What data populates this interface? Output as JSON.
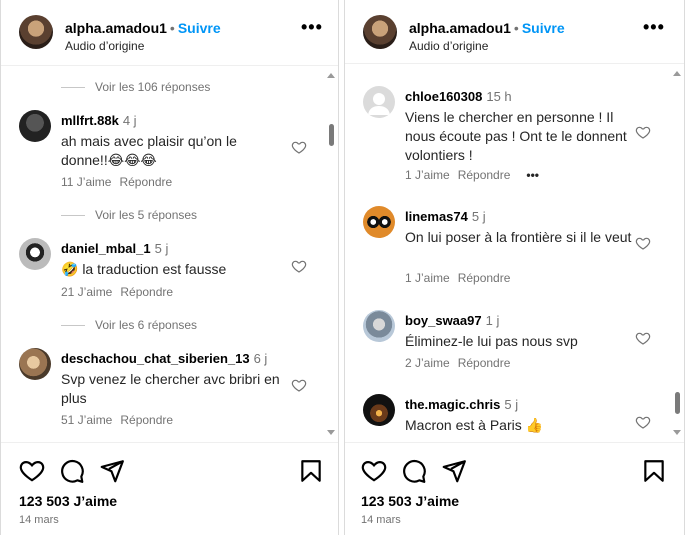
{
  "post": {
    "username": "alpha.amadou1",
    "separator": "•",
    "follow_label": "Suivre",
    "audio_label": "Audio d’origine",
    "more_label": "•••",
    "likes": "123 503 J’aime",
    "date": "14 mars"
  },
  "left": {
    "items": [
      {
        "type": "replies",
        "label": "Voir les 106 réponses"
      },
      {
        "type": "comment",
        "username": "mllfrt.88k",
        "time": "4 j",
        "text": "ah mais avec plaisir qu’on le donne!!😂😂😂",
        "likes": "11 J’aime",
        "reply": "Répondre"
      },
      {
        "type": "replies",
        "label": "Voir les 5 réponses"
      },
      {
        "type": "comment",
        "username": "daniel_mbal_1",
        "time": "5 j",
        "text": "🤣 la traduction est fausse",
        "likes": "21 J’aime",
        "reply": "Répondre"
      },
      {
        "type": "replies",
        "label": "Voir les 6 réponses"
      },
      {
        "type": "comment",
        "username": "deschachou_chat_siberien_13",
        "time": "6 j",
        "text": "Svp venez le chercher avc bribri en plus",
        "likes": "51 J’aime",
        "reply": "Répondre"
      }
    ]
  },
  "right": {
    "items": [
      {
        "type": "comment",
        "username": "chloe160308",
        "time": "15 h",
        "text": "Viens le chercher en personne ! Il nous écoute pas ! Ont te le donnent volontiers !",
        "likes": "1 J’aime",
        "reply": "Répondre",
        "more": "•••"
      },
      {
        "type": "comment",
        "username": "linemas74",
        "time": "5 j",
        "text": "On lui poser à la frontière si il le veut",
        "likes": "1 J’aime",
        "reply": "Répondre"
      },
      {
        "type": "comment",
        "username": "boy_swaa97",
        "time": "1 j",
        "text": "Éliminez-le lui pas nous svp",
        "likes": "2 J’aime",
        "reply": "Répondre"
      },
      {
        "type": "comment",
        "username": "the.magic.chris",
        "time": "5 j",
        "text": "Macron est à Paris 👍",
        "likes": "",
        "reply": ""
      }
    ]
  },
  "icons": {
    "like": "heart-icon",
    "comment": "comment-icon",
    "share": "send-icon",
    "save": "bookmark-icon",
    "comment_like": "small-heart-icon"
  },
  "colors": {
    "follow": "#0095f6",
    "secondary_text": "#737373",
    "border": "#dbdbdb"
  }
}
